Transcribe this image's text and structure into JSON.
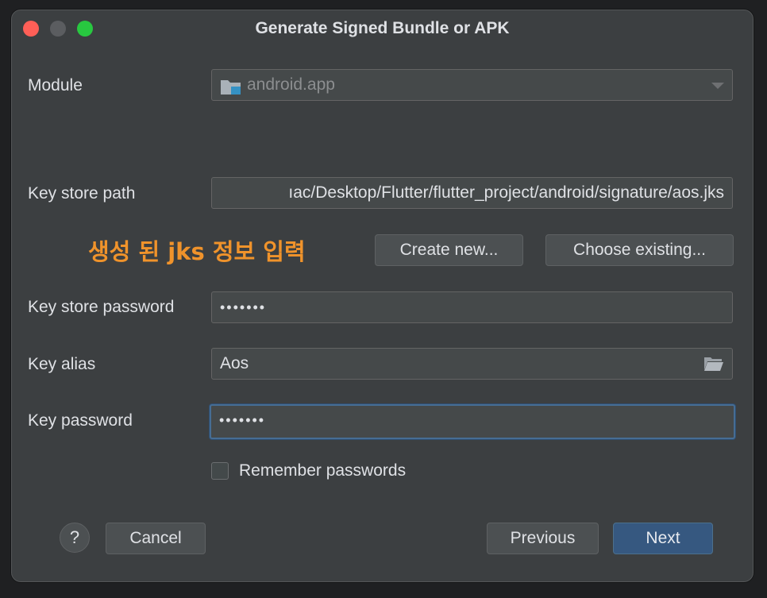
{
  "window": {
    "title": "Generate Signed Bundle or APK"
  },
  "colors": {
    "background": "#3c3f41",
    "accent": "#365880",
    "annotation": "#f0932b"
  },
  "form": {
    "module": {
      "label": "Module",
      "value": "android.app",
      "icon": "module-folder-icon"
    },
    "key_store_path": {
      "label": "Key store path",
      "value": "ıac/Desktop/Flutter/flutter_project/android/signature/aos.jks"
    },
    "create_new_label": "Create new...",
    "choose_existing_label": "Choose existing...",
    "key_store_password": {
      "label": "Key store password",
      "value": "•••••••"
    },
    "key_alias": {
      "label": "Key alias",
      "value": "Aos",
      "icon": "open-folder-icon"
    },
    "key_password": {
      "label": "Key password",
      "value": "•••••••"
    },
    "remember_passwords": {
      "label": "Remember passwords",
      "checked": false
    }
  },
  "annotation": {
    "text": "생성 된 jks 정보 입력"
  },
  "footer": {
    "help_label": "?",
    "cancel_label": "Cancel",
    "previous_label": "Previous",
    "next_label": "Next"
  }
}
